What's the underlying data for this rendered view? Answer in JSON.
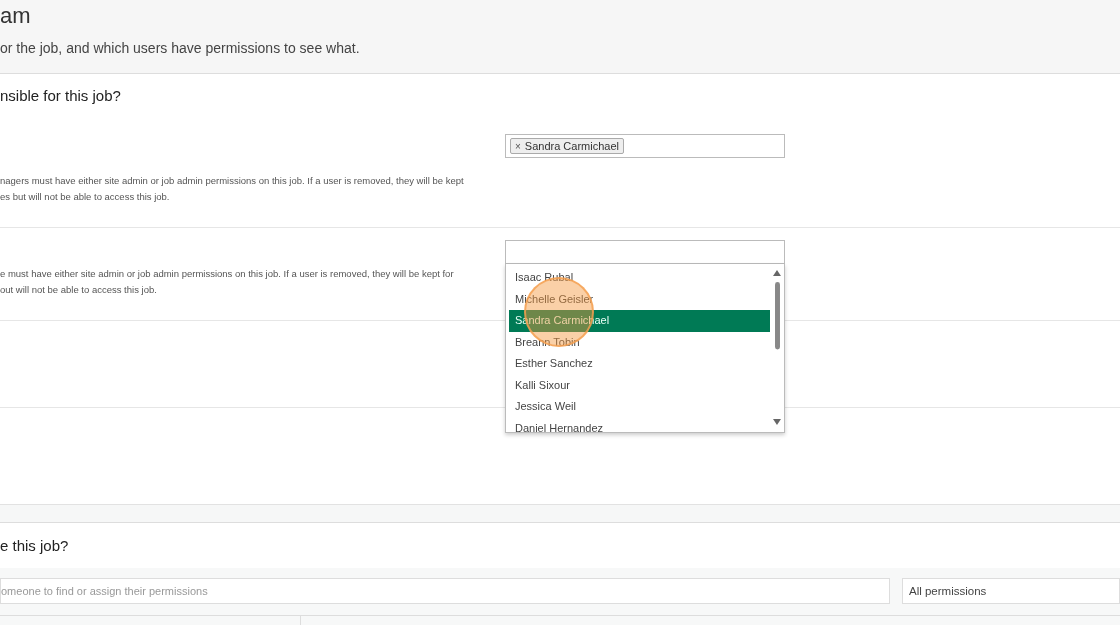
{
  "header": {
    "title": "am",
    "subtitle": "or the job, and which users have permissions to see what."
  },
  "responsible": {
    "heading": "nsible for this job?",
    "rows": [
      {
        "kind": "tags",
        "description": [
          "nagers must have either site admin or job admin permissions on this job. If a user is removed, they will be kept",
          "es but will not be able to access this job."
        ],
        "tags": [
          {
            "remove": "×",
            "label": "Sandra Carmichael"
          }
        ]
      },
      {
        "kind": "dropdown",
        "description": [
          "e must have either site admin or job admin permissions on this job. If a user is removed, they will be kept for",
          "out will not be able to access this job."
        ],
        "options": [
          {
            "label": "Isaac Rubal",
            "selected": false
          },
          {
            "label": "Michelle Geisler",
            "selected": false
          },
          {
            "label": "Sandra Carmichael",
            "selected": true
          },
          {
            "label": "Breann Tobin",
            "selected": false
          },
          {
            "label": "Esther Sanchez",
            "selected": false
          },
          {
            "label": "Kalli Sixour",
            "selected": false
          },
          {
            "label": "Jessica Weil",
            "selected": false
          },
          {
            "label": "Daniel Hernandez",
            "selected": false
          }
        ]
      }
    ]
  },
  "access": {
    "heading": "e this job?",
    "search": {
      "placeholder": "omeone to find or assign their permissions"
    },
    "filter": {
      "value": "All permissions"
    }
  }
}
